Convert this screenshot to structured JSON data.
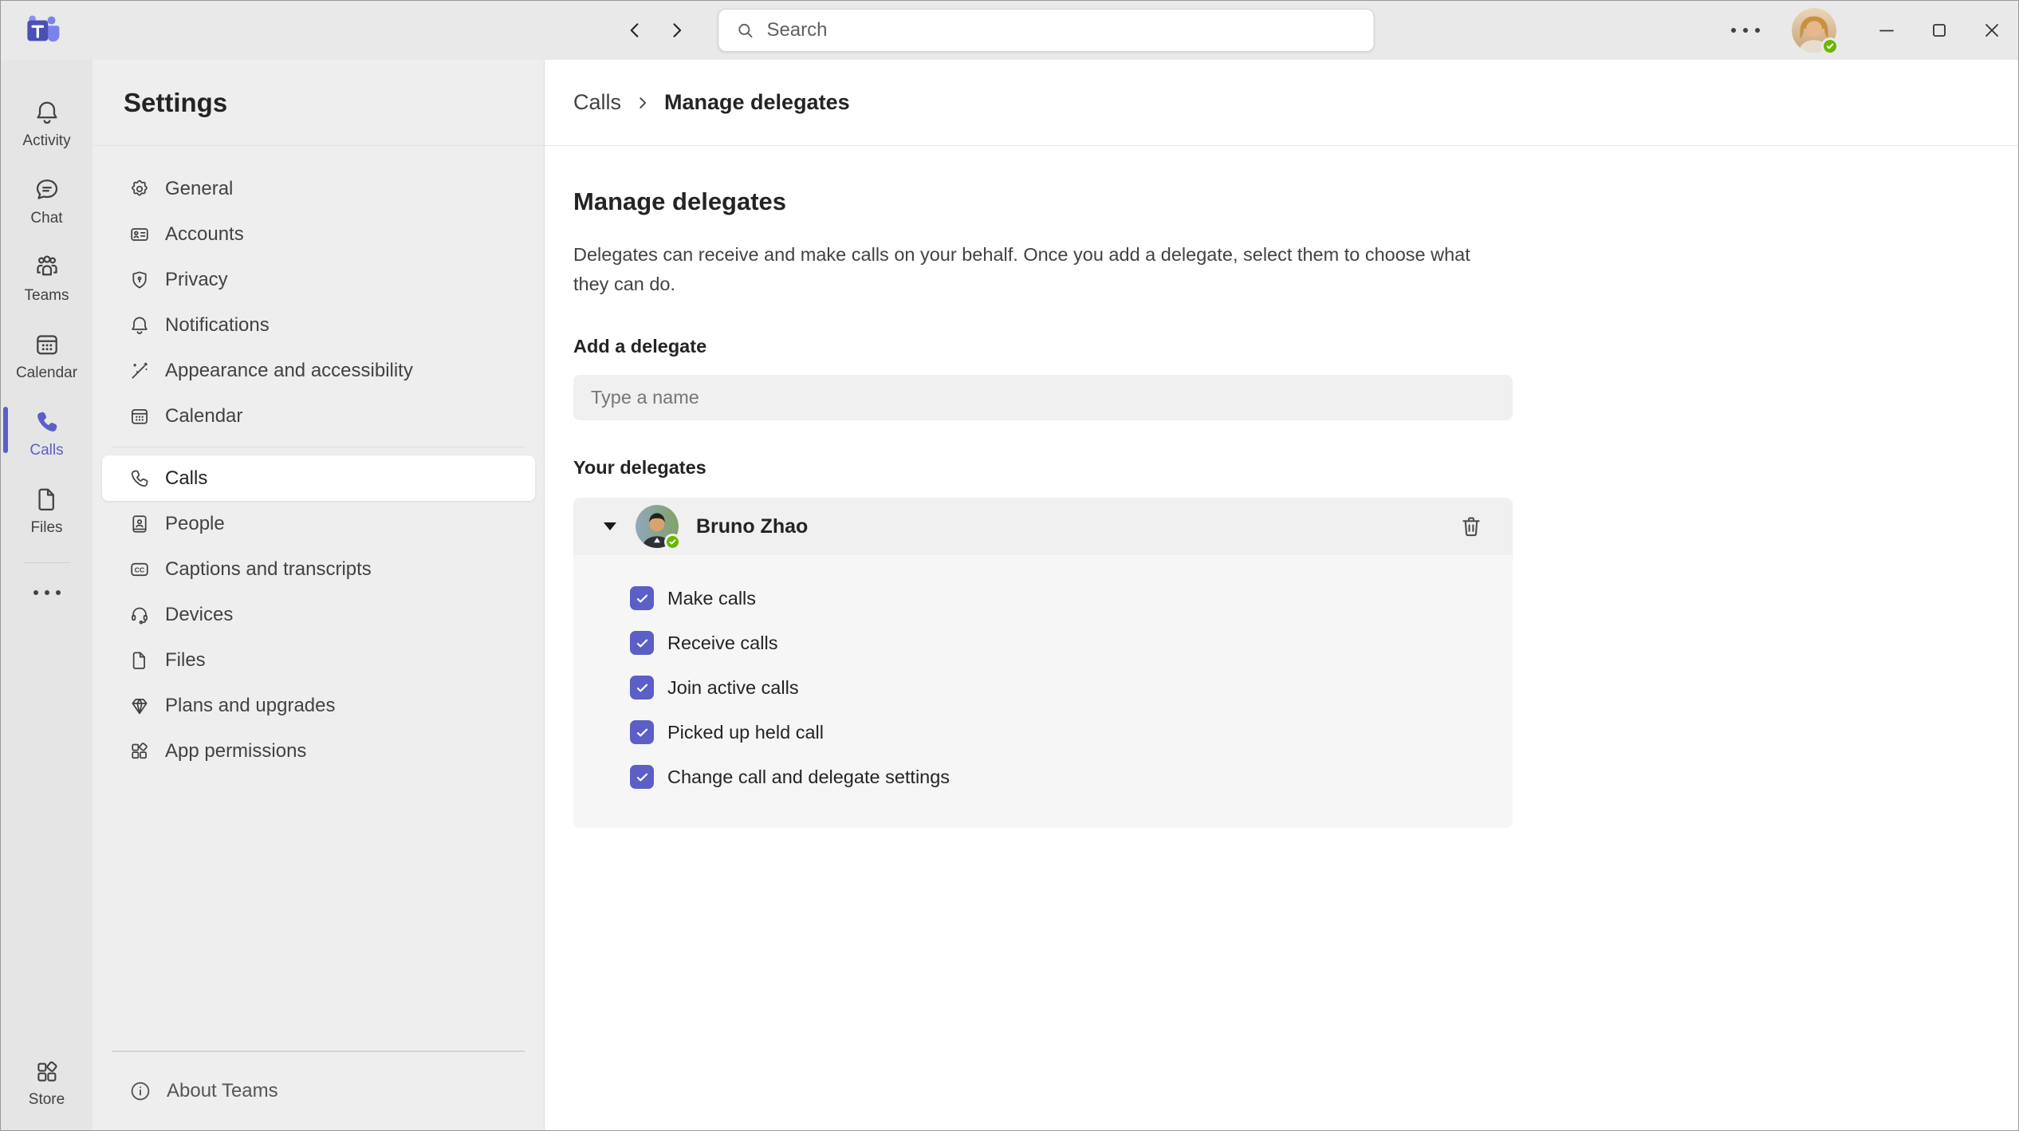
{
  "titlebar": {
    "search_placeholder": "Search"
  },
  "rail": {
    "items": [
      {
        "label": "Activity",
        "active": false
      },
      {
        "label": "Chat",
        "active": false
      },
      {
        "label": "Teams",
        "active": false
      },
      {
        "label": "Calendar",
        "active": false
      },
      {
        "label": "Calls",
        "active": true
      },
      {
        "label": "Files",
        "active": false
      }
    ],
    "store_label": "Store"
  },
  "settings_nav": {
    "title": "Settings",
    "items": [
      {
        "label": "General",
        "selected": false
      },
      {
        "label": "Accounts",
        "selected": false
      },
      {
        "label": "Privacy",
        "selected": false
      },
      {
        "label": "Notifications",
        "selected": false
      },
      {
        "label": "Appearance and accessibility",
        "selected": false
      },
      {
        "label": "Calendar",
        "selected": false
      },
      {
        "label": "Calls",
        "selected": true
      },
      {
        "label": "People",
        "selected": false
      },
      {
        "label": "Captions and transcripts",
        "selected": false
      },
      {
        "label": "Devices",
        "selected": false
      },
      {
        "label": "Files",
        "selected": false
      },
      {
        "label": "Plans and upgrades",
        "selected": false
      },
      {
        "label": "App permissions",
        "selected": false
      }
    ],
    "about_label": "About Teams"
  },
  "main": {
    "breadcrumb": {
      "parent": "Calls",
      "current": "Manage delegates"
    },
    "heading": "Manage delegates",
    "description": "Delegates can receive and make calls on your behalf. Once you add a delegate, select them to choose what they can do.",
    "add_delegate_label": "Add a delegate",
    "add_delegate_placeholder": "Type a name",
    "your_delegates_label": "Your delegates",
    "delegate": {
      "name": "Bruno Zhao",
      "presence": "available"
    },
    "permissions": [
      {
        "label": "Make calls",
        "checked": true
      },
      {
        "label": "Receive calls",
        "checked": true
      },
      {
        "label": "Join active calls",
        "checked": true
      },
      {
        "label": "Picked up held call",
        "checked": true
      },
      {
        "label": "Change call and delegate settings",
        "checked": true
      }
    ]
  },
  "colors": {
    "accent": "#5b5fc7",
    "presence_available": "#6bb700"
  }
}
